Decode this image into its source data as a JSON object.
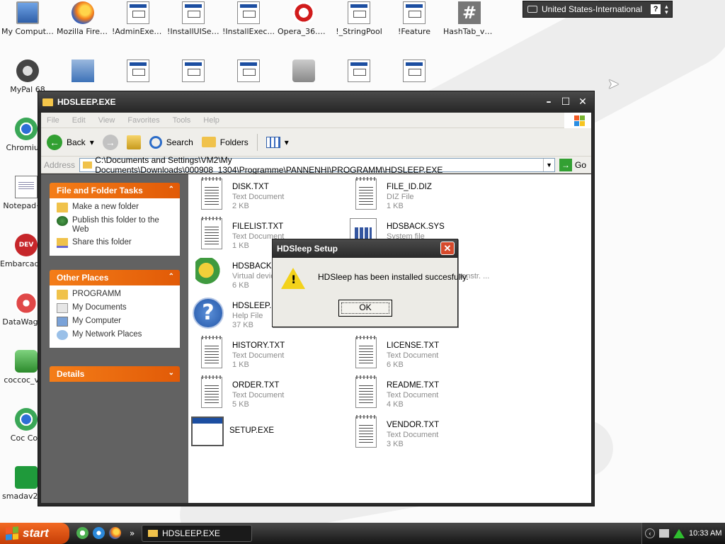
{
  "desktop_icons": [
    {
      "label": "My Computer",
      "icon": "computer-icon"
    },
    {
      "label": "Mozilla Firefox",
      "icon": "firefox-icon"
    },
    {
      "label": "!AdminExec...",
      "icon": "exe-icon"
    },
    {
      "label": "!InstallUISeq...",
      "icon": "exe-icon"
    },
    {
      "label": "!InstallExec...",
      "icon": "exe-icon"
    },
    {
      "label": "Opera_36.0....",
      "icon": "opera-icon"
    },
    {
      "label": "!_StringPool",
      "icon": "exe-icon"
    },
    {
      "label": "!Feature",
      "icon": "exe-icon"
    },
    {
      "label": "HashTab_v5...",
      "icon": "hashtab-icon"
    },
    {
      "label": "MyPal 68",
      "icon": "mypal-icon"
    },
    {
      "label": "Chromium",
      "icon": "chromium-icon"
    },
    {
      "label": "Notepad++",
      "icon": "notepad-icon"
    },
    {
      "label": "Embarcadero Dev-C++",
      "icon": "devcpp-icon"
    },
    {
      "label": "DataWago...",
      "icon": "datawago-icon"
    },
    {
      "label": "coccoc_vi...",
      "icon": "coccoc-setup-icon"
    },
    {
      "label": "Coc Coc",
      "icon": "coccoc-icon"
    },
    {
      "label": "smadav20...",
      "icon": "smadav-icon"
    }
  ],
  "language_bar": {
    "text": "United States-International",
    "help": "?"
  },
  "window": {
    "title": "HDSLEEP.EXE",
    "menu": [
      "File",
      "Edit",
      "View",
      "Favorites",
      "Tools",
      "Help"
    ],
    "toolbar": {
      "back": "Back",
      "search": "Search",
      "folders": "Folders"
    },
    "address": {
      "label": "Address",
      "path": "C:\\Documents and Settings\\VM2\\My Documents\\Downloads\\000908_1304\\Programme\\PANNENHI\\PROGRAMM\\HDSLEEP.EXE",
      "go": "Go"
    },
    "tasks_panel": {
      "title": "File and Folder Tasks",
      "items": [
        "Make a new folder",
        "Publish this folder to the Web",
        "Share this folder"
      ]
    },
    "places_panel": {
      "title": "Other Places",
      "items": [
        "PROGRAMM",
        "My Documents",
        "My Computer",
        "My Network Places"
      ]
    },
    "details_panel": {
      "title": "Details"
    },
    "files": [
      {
        "name": "DISK.TXT",
        "type": "Text Document",
        "size": "2 KB"
      },
      {
        "name": "FILE_ID.DIZ",
        "type": "DIZ File",
        "size": "1 KB"
      },
      {
        "name": "FILELIST.TXT",
        "type": "Text Document",
        "size": "1 KB"
      },
      {
        "name": "HDSBACK.SYS",
        "type": "System file",
        "size": ""
      },
      {
        "name": "HDSBACK.VX",
        "type": "Virtual devic",
        "size": "6 KB"
      },
      {
        "name": "",
        "type": "nenstr. ...",
        "size": ""
      },
      {
        "name": "HDSLEEP.HL",
        "type": "Help File",
        "size": "37 KB"
      },
      {
        "name": "HISTORY.TXT",
        "type": "Text Document",
        "size": "1 KB"
      },
      {
        "name": "LICENSE.TXT",
        "type": "Text Document",
        "size": "6 KB"
      },
      {
        "name": "ORDER.TXT",
        "type": "Text Document",
        "size": "5 KB"
      },
      {
        "name": "README.TXT",
        "type": "Text Document",
        "size": "4 KB"
      },
      {
        "name": "SETUP.EXE",
        "type": "",
        "size": ""
      },
      {
        "name": "VENDOR.TXT",
        "type": "Text Document",
        "size": "3 KB"
      }
    ]
  },
  "dialog": {
    "title": "HDSleep Setup",
    "message": "HDSleep has been installed succesfully.",
    "ok": "OK"
  },
  "taskbar": {
    "start": "start",
    "task": "HDSLEEP.EXE",
    "clock": "10:33 AM"
  }
}
